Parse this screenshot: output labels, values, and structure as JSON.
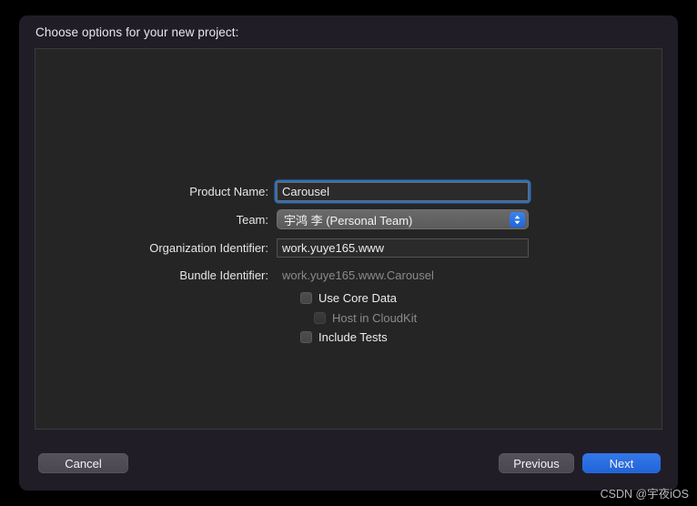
{
  "window": {
    "title": "Choose options for your new project:"
  },
  "form": {
    "fields": [
      {
        "label": "Product Name:",
        "value": "Carousel",
        "type": "textfield",
        "focused": true
      },
      {
        "label": "Team:",
        "value": "宇鸿 李 (Personal Team)",
        "type": "popup"
      },
      {
        "label": "Organization Identifier:",
        "value": "work.yuye165.www",
        "type": "textfield",
        "focused": false
      },
      {
        "label": "Bundle Identifier:",
        "value": "work.yuye165.www.Carousel",
        "type": "static"
      }
    ],
    "checkboxes": [
      {
        "label": "Use Core Data",
        "checked": false,
        "disabled": false
      },
      {
        "label": "Host in CloudKit",
        "checked": false,
        "disabled": true
      },
      {
        "label": "Include Tests",
        "checked": false,
        "disabled": false
      }
    ]
  },
  "footer": {
    "cancel_label": "Cancel",
    "previous_label": "Previous",
    "next_label": "Next"
  },
  "watermark": {
    "text": "CSDN @宇夜iOS"
  },
  "colors": {
    "accent_blue": "#2d6fe0",
    "window_bg": "#211d27",
    "panel_bg": "#252525",
    "focus_ring": "#2f6fb8"
  }
}
